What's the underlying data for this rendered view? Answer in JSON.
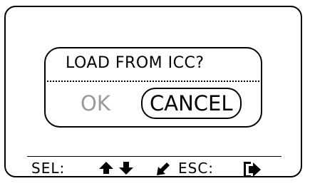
{
  "dialog": {
    "title": "LOAD FROM ICC?",
    "ok_label": "OK",
    "cancel_label": "CANCEL",
    "selected_option": "CANCEL"
  },
  "footer": {
    "select_label": "SEL:",
    "escape_label": "ESC:",
    "icons": [
      "arrow-up-icon",
      "arrow-down-icon",
      "enter-icon",
      "exit-door-icon"
    ]
  }
}
